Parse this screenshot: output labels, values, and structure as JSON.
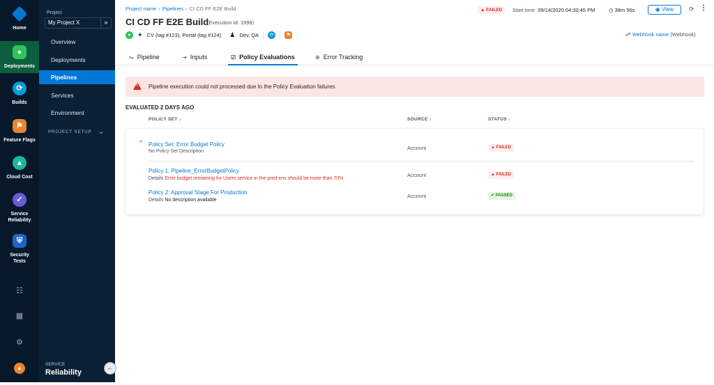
{
  "rail": {
    "items": [
      {
        "label": "Home",
        "icon": "home-hex-icon"
      },
      {
        "label": "Deployments",
        "icon": "deployments-icon"
      },
      {
        "label": "Builds",
        "icon": "builds-icon"
      },
      {
        "label": "Feature Flags",
        "icon": "feature-flags-icon"
      },
      {
        "label": "Cloud Cost",
        "icon": "cloud-cost-icon"
      },
      {
        "label": "Service Reliability",
        "icon": "service-reliability-icon"
      },
      {
        "label": "Security Tests",
        "icon": "security-tests-icon"
      }
    ],
    "bottom_icons": [
      "chart-icon",
      "grid-icon",
      "gear-icon",
      "user-avatar-icon"
    ]
  },
  "project_nav": {
    "project_label": "Project",
    "project_name": "My Project X",
    "items": [
      "Overview",
      "Deployments",
      "Pipelines",
      "Services",
      "Environment"
    ],
    "active_item": "Pipelines",
    "project_setup": "PROJECT SETUP",
    "module_caption": "SERVICE",
    "module_name": "Reliability"
  },
  "header": {
    "breadcrumb": [
      "Project name",
      "Pipelines",
      "CI CD FF E2E Build"
    ],
    "title": "CI CD FF E2E Build",
    "execution_id": "(Execution Id: 1998)",
    "tags": "CV (tag #123), Portal (tag #124)",
    "environments": "Dev, QA",
    "status": "FAILED",
    "start_time_label": "Start time",
    "start_time": "09/14/2020 04:30:45 PM",
    "duration": "38m 56s",
    "view_label": "View",
    "webhook_name": "Webhook name",
    "webhook_type": "(Webhook)"
  },
  "tabs": [
    {
      "label": "Pipeline",
      "icon": "pipeline-icon"
    },
    {
      "label": "Inputs",
      "icon": "inputs-icon"
    },
    {
      "label": "Policy Evaluations",
      "icon": "policy-icon"
    },
    {
      "label": "Error Tracking",
      "icon": "error-tracking-icon"
    }
  ],
  "active_tab": "Policy Evaluations",
  "alert": {
    "message": "Pipeline execution could not processed due to the Policy Evaluation failures"
  },
  "evaluations": {
    "heading": "EVALUATED 2 DAYS AGO",
    "columns": [
      "POLICY SET ↕",
      "SOURCE ↕",
      "STATUS ↕"
    ],
    "policy_set": {
      "title": "Policy Set: Error Budget Policy",
      "description": "No Policy Set Description",
      "source": "Account",
      "status": "FAILED"
    },
    "policies": [
      {
        "title": "Policy 1: Pipeline_ErrorBudgetPolicy",
        "details_label": "Details",
        "details": "Error budget remaining for Users service in the prod env should be more than 70%",
        "source": "Account",
        "status": "FAILED"
      },
      {
        "title": "Policy 2: Approval Stage For Production",
        "details_label": "Details",
        "details": "No description available",
        "source": "Account",
        "status": "PASSED"
      }
    ]
  },
  "colors": {
    "accent": "#0278d5",
    "failed": "#da291d",
    "passed": "#1b841d",
    "rail_bg": "#07182b"
  }
}
